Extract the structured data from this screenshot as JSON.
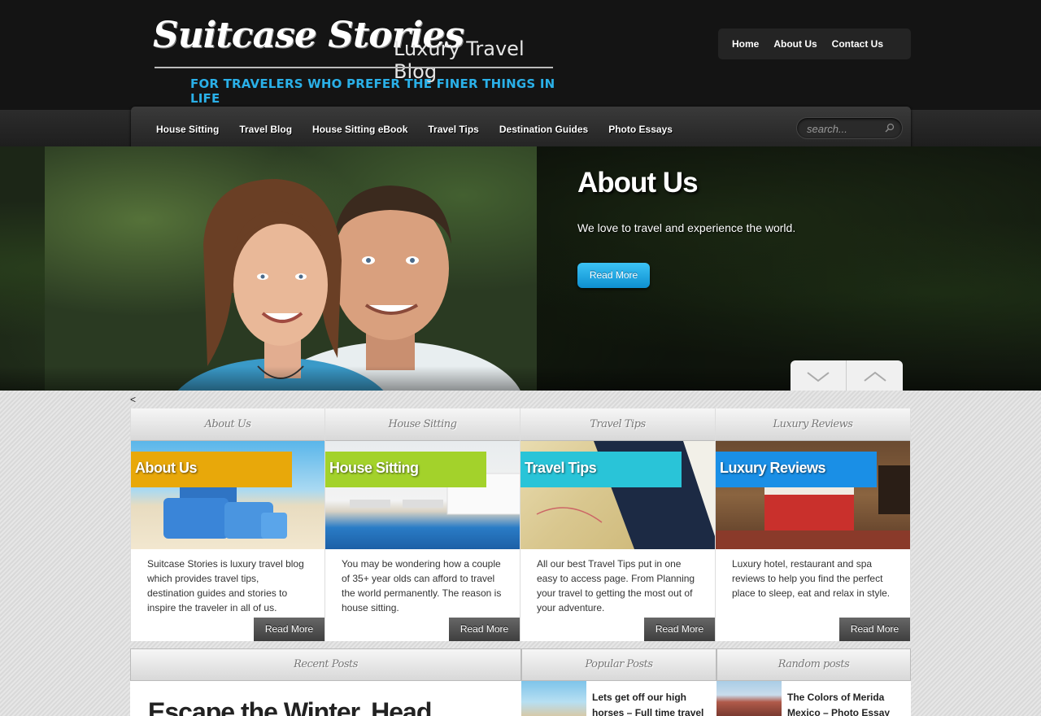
{
  "header": {
    "logo_script": "Suitcase Stories",
    "logo_subtitle": "Luxury Travel Blog",
    "logo_tagline": "FOR TRAVELERS WHO PREFER THE FINER THINGS IN LIFE",
    "top_nav": [
      "Home",
      "About Us",
      "Contact Us"
    ]
  },
  "main_nav": [
    "House Sitting",
    "Travel Blog",
    "House Sitting eBook",
    "Travel Tips",
    "Destination Guides",
    "Photo Essays"
  ],
  "search": {
    "placeholder": "search...",
    "icon": "magnifier-icon"
  },
  "hero": {
    "title": "About Us",
    "text": "We love to travel and experience the world.",
    "button": "Read More"
  },
  "stray_text": "<",
  "features": [
    {
      "heading": "About Us",
      "label": "About Us",
      "label_color": "#e8a80a",
      "text": "Suitcase Stories is luxury travel blog which provides travel tips, destination guides and stories to inspire the traveler in all of us.",
      "button": "Read More"
    },
    {
      "heading": "House Sitting",
      "label": "House Sitting",
      "label_color": "#a3d22b",
      "text": "You may be wondering how a couple of 35+ year olds can afford to travel the world permanently. The reason is house sitting.",
      "button": "Read More"
    },
    {
      "heading": "Travel Tips",
      "label": "Travel Tips",
      "label_color": "#29c4d8",
      "text": "All our best Travel Tips put in one easy to access page. From Planning your travel to getting the most out of your adventure.",
      "button": "Read More"
    },
    {
      "heading": "Luxury Reviews",
      "label": "Luxury Reviews",
      "label_color": "#1a8fe6",
      "text": "Luxury hotel, restaurant and spa reviews to help you find the perfect place to sleep, eat and relax in style.",
      "button": "Read More"
    }
  ],
  "bottom": {
    "recent": {
      "heading": "Recent Posts",
      "post_title": "Escape the Winter, Head"
    },
    "popular": {
      "heading": "Popular Posts",
      "post_title": "Lets get off our high horses – Full time travel"
    },
    "random": {
      "heading": "Random posts",
      "post_title": "The Colors of Merida Mexico – Photo Essay"
    }
  }
}
